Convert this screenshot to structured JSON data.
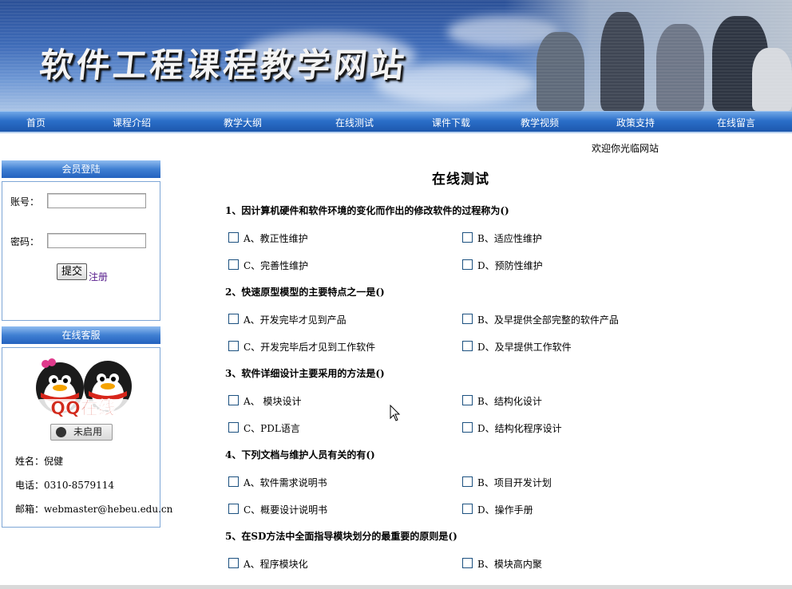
{
  "banner": {
    "title": "软件工程课程教学网站"
  },
  "nav": {
    "items": [
      "首页",
      "课程介绍",
      "教学大纲",
      "在线测试",
      "课件下载",
      "教学视频",
      "政策支持",
      "在线留言"
    ]
  },
  "welcome": "欢迎你光临网站",
  "login": {
    "header": "会员登陆",
    "account_label": "账号：",
    "password_label": "密码：",
    "account_value": "",
    "password_value": "",
    "submit_label": "提交",
    "register_label": "注册"
  },
  "service": {
    "header": "在线客服",
    "qq_logo_text": "QQ在线",
    "status_label": "未启用",
    "name_line": "姓名：倪健",
    "phone_line": "电话：0310-8579114",
    "email_line": "邮箱：webmaster@hebeu.edu.cn"
  },
  "main": {
    "title": "在线测试",
    "questions": [
      {
        "text": "1、因计算机硬件和软件环境的变化而作出的修改软件的过程称为()",
        "options": [
          "A、教正性维护",
          "B、适应性维护",
          "C、完善性维护",
          "D、预防性维护"
        ]
      },
      {
        "text": "2、快速原型模型的主要特点之一是()",
        "options": [
          "A、开发完毕才见到产品",
          "B、及早提供全部完整的软件产品",
          "C、开发完毕后才见到工作软件",
          "D、及早提供工作软件"
        ]
      },
      {
        "text": "3、软件详细设计主要采用的方法是()",
        "options": [
          "A、 模块设计",
          "B、结构化设计",
          "C、PDL语言",
          "D、结构化程序设计"
        ]
      },
      {
        "text": "4、下列文档与维护人员有关的有()",
        "options": [
          "A、软件需求说明书",
          "B、项目开发计划",
          "C、概要设计说明书",
          "D、操作手册"
        ]
      },
      {
        "text": "5、在SD方法中全面指导模块划分的最重要的原则是()",
        "options": [
          "A、程序模块化",
          "B、模块高内聚"
        ]
      }
    ]
  }
}
